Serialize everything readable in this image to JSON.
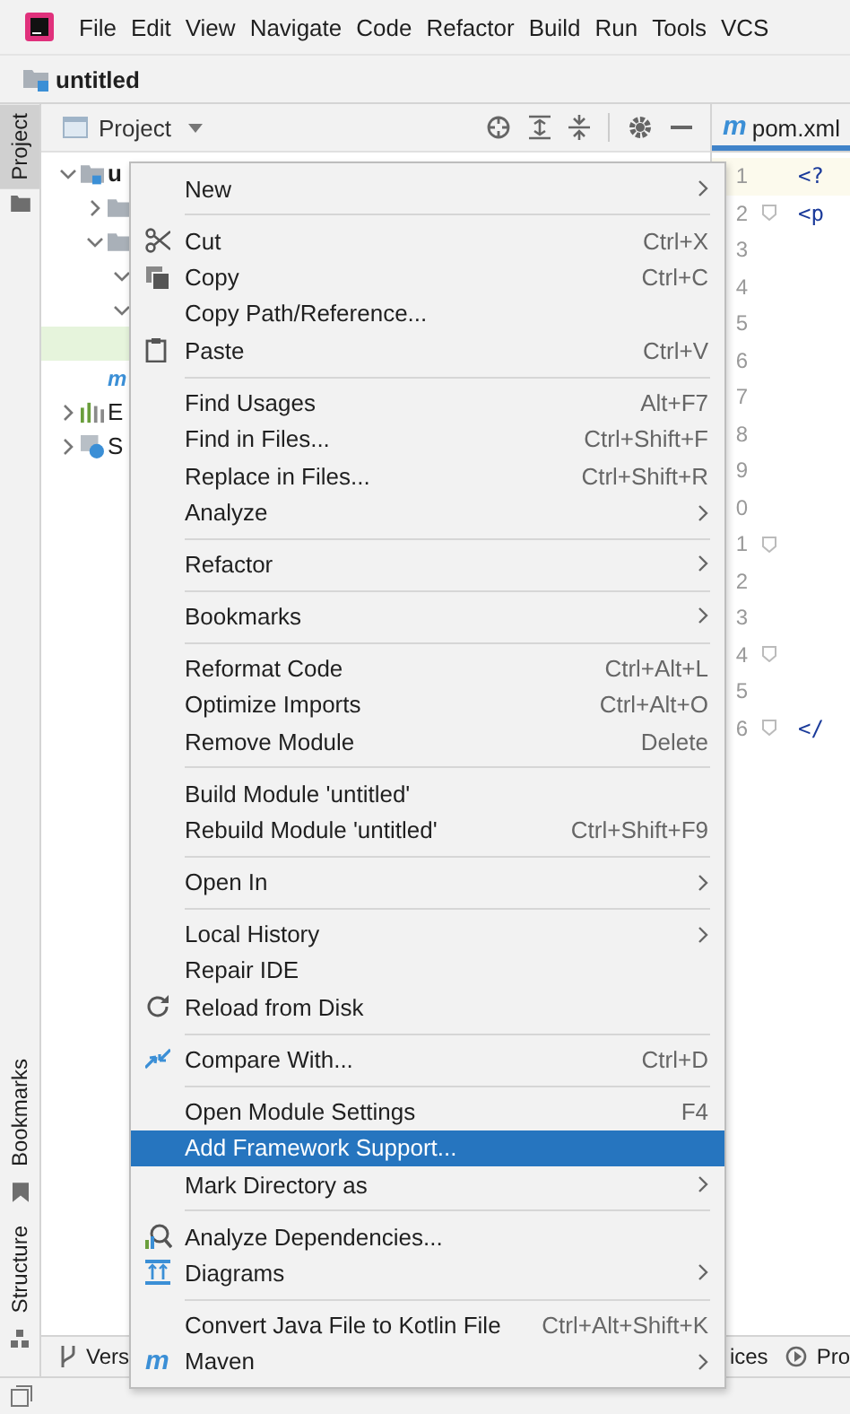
{
  "menu_bar": [
    {
      "label": "File"
    },
    {
      "label": "Edit"
    },
    {
      "label": "View"
    },
    {
      "label": "Navigate"
    },
    {
      "label": "Code"
    },
    {
      "label": "Refactor"
    },
    {
      "label": "Build"
    },
    {
      "label": "Run"
    },
    {
      "label": "Tools"
    },
    {
      "label": "VCS"
    }
  ],
  "breadcrumb": {
    "label": "untitled"
  },
  "tool_strip": {
    "top": [
      {
        "label": "Project",
        "selected": true
      }
    ],
    "bottom": [
      {
        "label": "Bookmarks",
        "selected": false
      },
      {
        "label": "Structure",
        "selected": false
      }
    ]
  },
  "project_panel": {
    "title": "Project",
    "tree": [
      {
        "kind": "folder",
        "label": "u",
        "expanded": true,
        "selected": false,
        "children": [
          {
            "kind": "folder",
            "expanded": false,
            "selected": false
          },
          {
            "kind": "folder",
            "expanded": true,
            "selected": false,
            "children": [
              {
                "expanded": true,
                "selected": false
              },
              {
                "expanded": true,
                "selected": false,
                "children": [
                  {
                    "selected": true
                  }
                ]
              }
            ]
          },
          {
            "kind": "maven",
            "glyph": "m",
            "selected": false
          }
        ]
      },
      {
        "kind": "libraries",
        "label": "E",
        "expanded": false,
        "selected": false
      },
      {
        "kind": "scratches",
        "label": "S",
        "expanded": false,
        "selected": false
      }
    ]
  },
  "editor": {
    "tab": {
      "glyph": "m",
      "label": "pom.xml",
      "selected": true
    },
    "lines": [
      {
        "number": "1",
        "code": "<?",
        "current": true,
        "fold": false
      },
      {
        "number": "2",
        "code": "<p",
        "current": false,
        "fold": true
      },
      {
        "number": "3",
        "current": false,
        "fold": false
      },
      {
        "number": "4",
        "current": false,
        "fold": false
      },
      {
        "number": "5",
        "current": false,
        "fold": false
      },
      {
        "number": "6",
        "current": false,
        "fold": false
      },
      {
        "number": "7",
        "current": false,
        "fold": false
      },
      {
        "number": "8",
        "current": false,
        "fold": false
      },
      {
        "number": "9",
        "current": false,
        "fold": false
      },
      {
        "number": "0",
        "current": false,
        "fold": false
      },
      {
        "number": "1",
        "current": false,
        "fold": true
      },
      {
        "number": "2",
        "current": false,
        "fold": false
      },
      {
        "number": "3",
        "current": false,
        "fold": false
      },
      {
        "number": "4",
        "current": false,
        "fold": true
      },
      {
        "number": "5",
        "current": false,
        "fold": false
      },
      {
        "number": "6",
        "code": "</",
        "current": false,
        "fold": true
      }
    ]
  },
  "context_menu": {
    "items": [
      {
        "kind": "item",
        "label": "New",
        "submenu": true,
        "selected": false
      },
      {
        "kind": "separator"
      },
      {
        "kind": "item",
        "label": "Cut",
        "shortcut": "Ctrl+X",
        "selected": false
      },
      {
        "kind": "item",
        "label": "Copy",
        "shortcut": "Ctrl+C",
        "selected": false
      },
      {
        "kind": "item",
        "label": "Copy Path/Reference...",
        "selected": false
      },
      {
        "kind": "item",
        "label": "Paste",
        "shortcut": "Ctrl+V",
        "selected": false
      },
      {
        "kind": "separator"
      },
      {
        "kind": "item",
        "label": "Find Usages",
        "shortcut": "Alt+F7",
        "selected": false
      },
      {
        "kind": "item",
        "label": "Find in Files...",
        "shortcut": "Ctrl+Shift+F",
        "selected": false
      },
      {
        "kind": "item",
        "label": "Replace in Files...",
        "shortcut": "Ctrl+Shift+R",
        "selected": false
      },
      {
        "kind": "item",
        "label": "Analyze",
        "submenu": true,
        "selected": false
      },
      {
        "kind": "separator"
      },
      {
        "kind": "item",
        "label": "Refactor",
        "submenu": true,
        "selected": false
      },
      {
        "kind": "separator"
      },
      {
        "kind": "item",
        "label": "Bookmarks",
        "submenu": true,
        "selected": false
      },
      {
        "kind": "separator"
      },
      {
        "kind": "item",
        "label": "Reformat Code",
        "shortcut": "Ctrl+Alt+L",
        "selected": false
      },
      {
        "kind": "item",
        "label": "Optimize Imports",
        "shortcut": "Ctrl+Alt+O",
        "selected": false
      },
      {
        "kind": "item",
        "label": "Remove Module",
        "shortcut": "Delete",
        "selected": false
      },
      {
        "kind": "separator"
      },
      {
        "kind": "item",
        "label": "Build Module 'untitled'",
        "selected": false
      },
      {
        "kind": "item",
        "label": "Rebuild Module 'untitled'",
        "shortcut": "Ctrl+Shift+F9",
        "selected": false
      },
      {
        "kind": "separator"
      },
      {
        "kind": "item",
        "label": "Open In",
        "submenu": true,
        "selected": false
      },
      {
        "kind": "separator"
      },
      {
        "kind": "item",
        "label": "Local History",
        "submenu": true,
        "selected": false
      },
      {
        "kind": "item",
        "label": "Repair IDE",
        "selected": false
      },
      {
        "kind": "item",
        "label": "Reload from Disk",
        "selected": false
      },
      {
        "kind": "separator"
      },
      {
        "kind": "item",
        "label": "Compare With...",
        "shortcut": "Ctrl+D",
        "selected": false
      },
      {
        "kind": "separator"
      },
      {
        "kind": "item",
        "label": "Open Module Settings",
        "shortcut": "F4",
        "selected": false
      },
      {
        "kind": "item",
        "label": "Add Framework Support...",
        "selected": true
      },
      {
        "kind": "item",
        "label": "Mark Directory as",
        "submenu": true,
        "selected": false
      },
      {
        "kind": "separator"
      },
      {
        "kind": "item",
        "label": "Analyze Dependencies...",
        "selected": false
      },
      {
        "kind": "item",
        "label": "Diagrams",
        "submenu": true,
        "selected": false
      },
      {
        "kind": "separator"
      },
      {
        "kind": "item",
        "label": "Convert Java File to Kotlin File",
        "shortcut": "Ctrl+Alt+Shift+K",
        "selected": false
      },
      {
        "kind": "item",
        "label": "Maven",
        "glyph": "m",
        "submenu": true,
        "selected": false
      }
    ]
  },
  "bottom_bar": {
    "left": [
      {
        "label": "Vers"
      }
    ],
    "right": [
      {
        "label": "ices"
      },
      {
        "label": "Pro"
      }
    ]
  }
}
